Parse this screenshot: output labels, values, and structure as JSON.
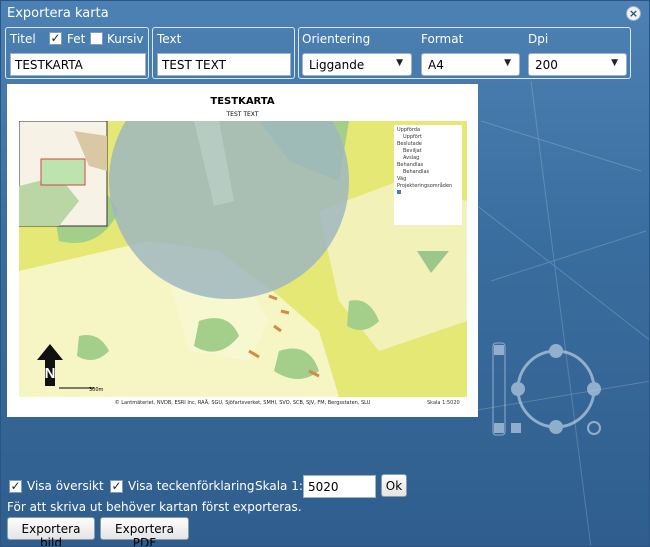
{
  "window": {
    "title": "Exportera karta",
    "close_icon": "close-icon"
  },
  "title_panel": {
    "label": "Titel",
    "bold_label": "Fet",
    "bold_checked": true,
    "italic_label": "Kursiv",
    "italic_checked": false,
    "value": "TESTKARTA"
  },
  "text_panel": {
    "label": "Text",
    "value": "TEST TEXT"
  },
  "settings_panel": {
    "orientation_label": "Orientering",
    "orientation_value": "Liggande",
    "format_label": "Format",
    "format_value": "A4",
    "dpi_label": "Dpi",
    "dpi_value": "200"
  },
  "preview": {
    "map_title": "TESTKARTA",
    "map_subtitle": "TEST TEXT",
    "legend": [
      "Uppförda",
      "Uppfört",
      "Beslutade",
      "Beviljat",
      "Avslag",
      "Behandlas",
      "Behandlas",
      "Väg",
      "Projekteringsområden"
    ],
    "scale_bar_label": "300m",
    "north_label": "N",
    "copyright": "© Lantmäteriet, NVDB, ESRI Inc, RAÄ, SGU, Sjöfartsverket, SMHI, SVO, SCB, SJV, FM, Bergsstaten, SLU",
    "scale_text": "Skala 1:5020"
  },
  "options": {
    "overview_label": "Visa översikt",
    "overview_checked": true,
    "legend_label": "Visa teckenförklaring",
    "legend_checked": true,
    "scale_label": "Skala 1:",
    "scale_value": "5020",
    "ok_label": "Ok"
  },
  "info_text": "För att skriva ut behöver kartan först exporteras.",
  "buttons": {
    "export_image": "Exportera bild",
    "export_pdf": "Exportera PDF"
  },
  "colors": {
    "dialog_bg": "#3f6f9e",
    "map_yellow": "#e5e875",
    "map_green": "#a3cf8a",
    "buffer_gray": "#9fb7bf",
    "legend_swatch": "#4a79c0"
  }
}
